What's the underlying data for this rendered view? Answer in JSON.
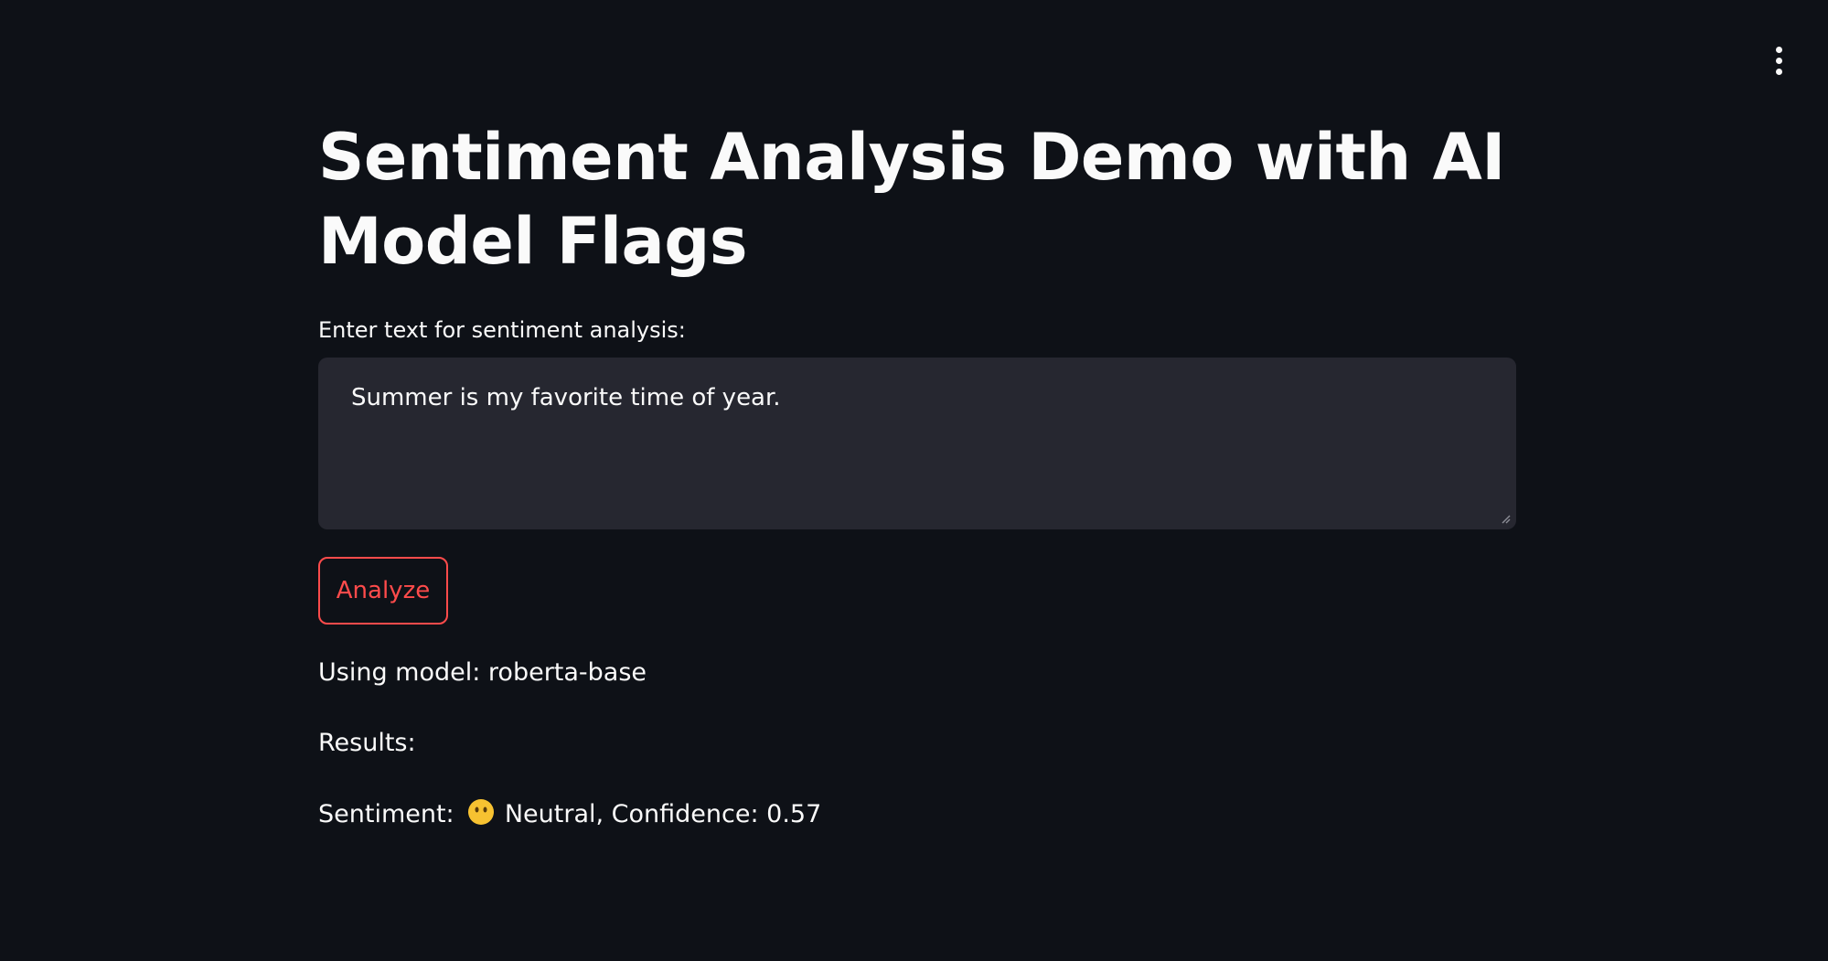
{
  "header": {
    "menu_icon": "kebab-menu-icon"
  },
  "main": {
    "title": "Sentiment Analysis Demo with AI Model Flags",
    "input_label": "Enter text for sentiment analysis:",
    "input_value": "Summer is my favorite time of year.",
    "analyze_button_label": "Analyze",
    "model_line": "Using model: roberta-base",
    "results_heading": "Results:",
    "sentiment_prefix": "Sentiment:",
    "sentiment_emoji_icon": "neutral-face-icon",
    "sentiment_value": "Neutral, Confidence: 0.57"
  },
  "colors": {
    "background": "#0e1117",
    "text": "#fafafa",
    "input_background": "#262730",
    "accent": "#ff4b4b"
  }
}
